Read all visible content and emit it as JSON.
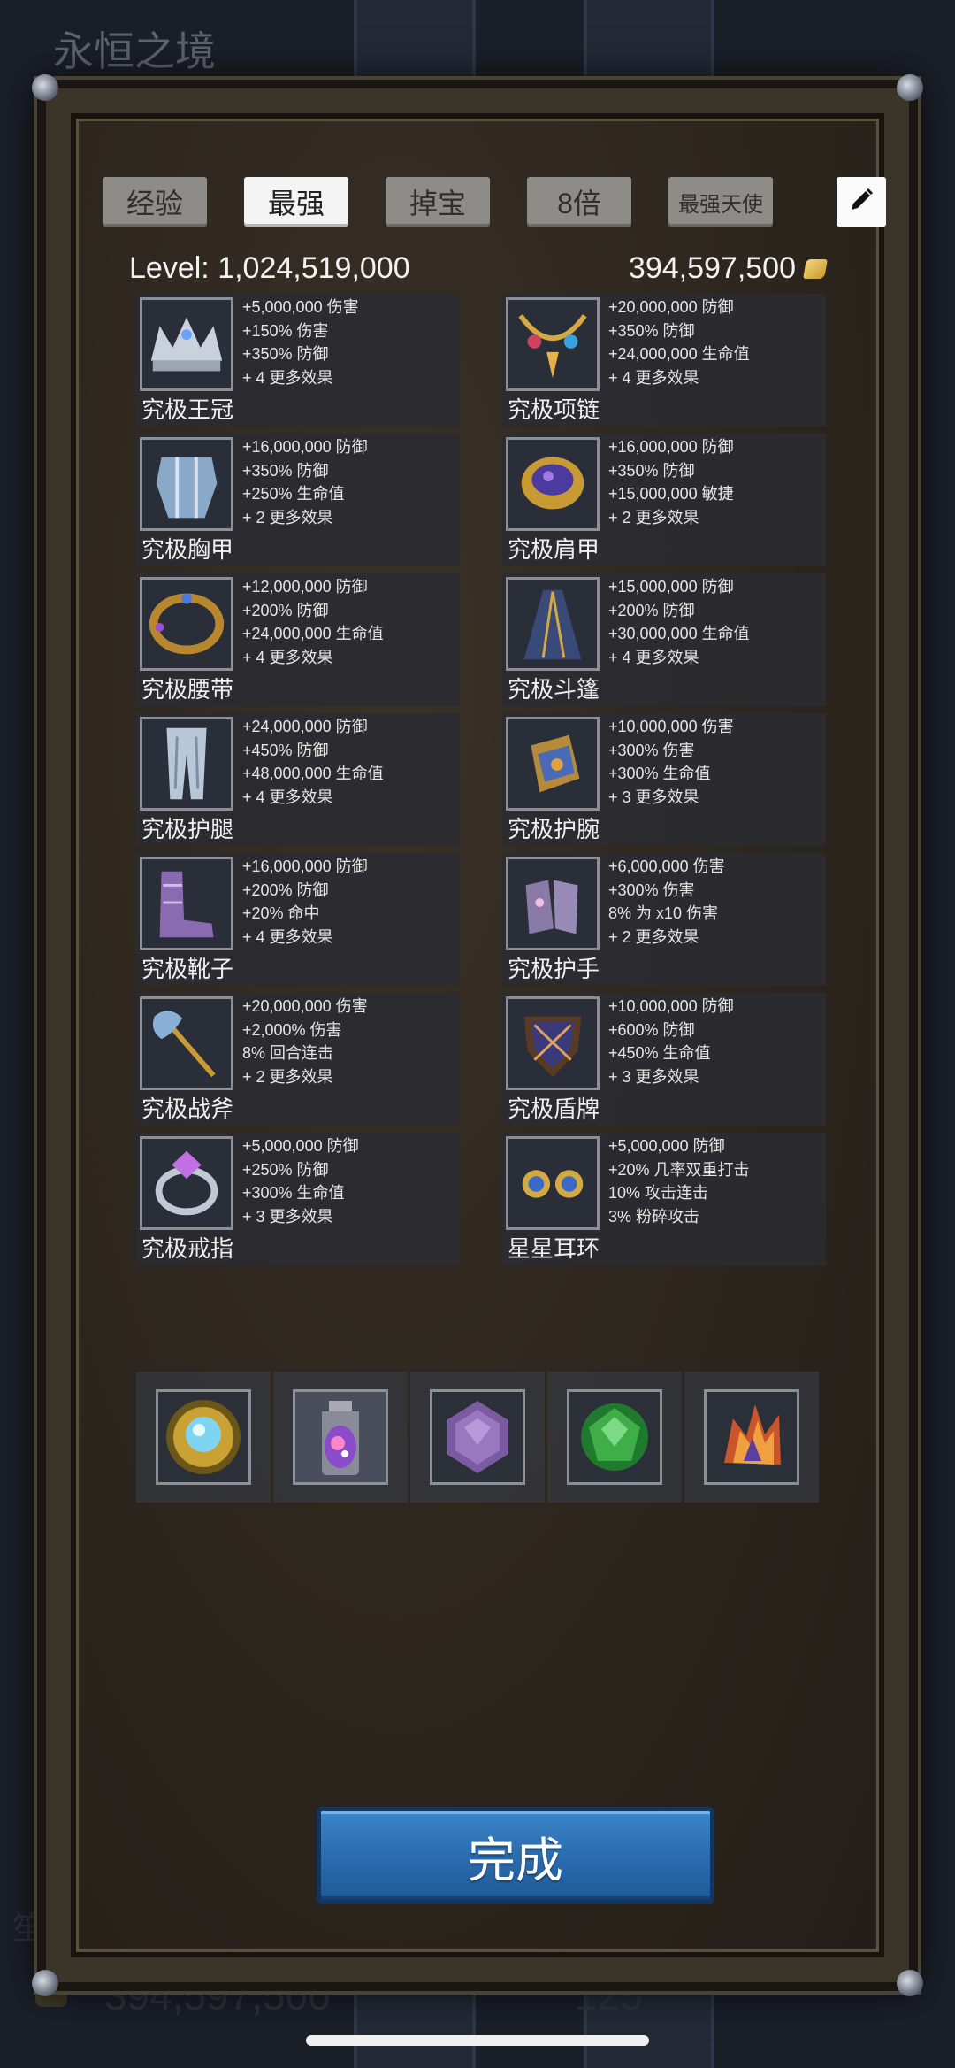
{
  "background": {
    "title": "永恒之境",
    "bottom_gold": "394,597,500",
    "bottom_count": "125",
    "bottom_left_char": "笙"
  },
  "tabs": [
    {
      "label": "经验",
      "active": false
    },
    {
      "label": "最强",
      "active": true
    },
    {
      "label": "掉宝",
      "active": false
    },
    {
      "label": "8倍",
      "active": false
    },
    {
      "label": "最强天使",
      "active": false
    }
  ],
  "edit_icon": "pencil-icon",
  "level": {
    "label": "Level:",
    "value": "1,024,519,000"
  },
  "gold": {
    "value": "394,597,500",
    "icon": "gold-coin-icon"
  },
  "items": [
    {
      "name": "究极王冠",
      "icon": "crown-icon",
      "stats": [
        "+5,000,000 伤害",
        "+150% 伤害",
        "+350% 防御",
        "+ 4 更多效果"
      ]
    },
    {
      "name": "究极项链",
      "icon": "necklace-icon",
      "stats": [
        "+20,000,000 防御",
        "+350% 防御",
        "+24,000,000 生命值",
        "+ 4 更多效果"
      ]
    },
    {
      "name": "究极胸甲",
      "icon": "chestplate-icon",
      "stats": [
        "+16,000,000 防御",
        "+350% 防御",
        "+250% 生命值",
        "+ 2 更多效果"
      ]
    },
    {
      "name": "究极肩甲",
      "icon": "shoulder-armor-icon",
      "stats": [
        "+16,000,000 防御",
        "+350% 防御",
        "+15,000,000 敏捷",
        "+ 2 更多效果"
      ]
    },
    {
      "name": "究极腰带",
      "icon": "belt-icon",
      "stats": [
        "+12,000,000 防御",
        "+200% 防御",
        "+24,000,000 生命值",
        "+ 4 更多效果"
      ]
    },
    {
      "name": "究极斗篷",
      "icon": "cloak-icon",
      "stats": [
        "+15,000,000 防御",
        "+200% 防御",
        "+30,000,000 生命值",
        "+ 4 更多效果"
      ]
    },
    {
      "name": "究极护腿",
      "icon": "leggings-icon",
      "stats": [
        "+24,000,000 防御",
        "+450% 防御",
        "+48,000,000 生命值",
        "+ 4 更多效果"
      ]
    },
    {
      "name": "究极护腕",
      "icon": "bracer-icon",
      "stats": [
        "+10,000,000 伤害",
        "+300% 伤害",
        "+300% 生命值",
        "+ 3 更多效果"
      ]
    },
    {
      "name": "究极靴子",
      "icon": "boots-icon",
      "stats": [
        "+16,000,000 防御",
        "+200% 防御",
        "+20% 命中",
        "+ 4 更多效果"
      ]
    },
    {
      "name": "究极护手",
      "icon": "gauntlets-icon",
      "stats": [
        "+6,000,000 伤害",
        "+300% 伤害",
        "8% 为 x10 伤害",
        "+ 2 更多效果"
      ]
    },
    {
      "name": "究极战斧",
      "icon": "battle-axe-icon",
      "stats": [
        "+20,000,000 伤害",
        "+2,000% 伤害",
        "8% 回合连击",
        "+ 2 更多效果"
      ]
    },
    {
      "name": "究极盾牌",
      "icon": "shield-icon",
      "stats": [
        "+10,000,000 防御",
        "+600% 防御",
        "+450% 生命值",
        "+ 3 更多效果"
      ]
    },
    {
      "name": "究极戒指",
      "icon": "ring-icon",
      "stats": [
        "+5,000,000 防御",
        "+250% 防御",
        "+300% 生命值",
        "+ 3 更多效果"
      ]
    },
    {
      "name": "星星耳环",
      "icon": "earrings-icon",
      "stats": [
        "+5,000,000 防御",
        "+20% 几率双重打击",
        "10% 攻击连击",
        "3% 粉碎攻击"
      ]
    }
  ],
  "gems": [
    {
      "icon": "amulet-orb-icon"
    },
    {
      "icon": "galaxy-jar-icon"
    },
    {
      "icon": "purple-gem-icon"
    },
    {
      "icon": "green-gem-icon"
    },
    {
      "icon": "fire-crystal-icon"
    }
  ],
  "done_button": "完成",
  "colors": {
    "accent_blue": "#2c6fb2",
    "panel_bg": "#2d261e",
    "tab_active": "#f4f4f4",
    "tab_inactive": "#8e8c88"
  }
}
